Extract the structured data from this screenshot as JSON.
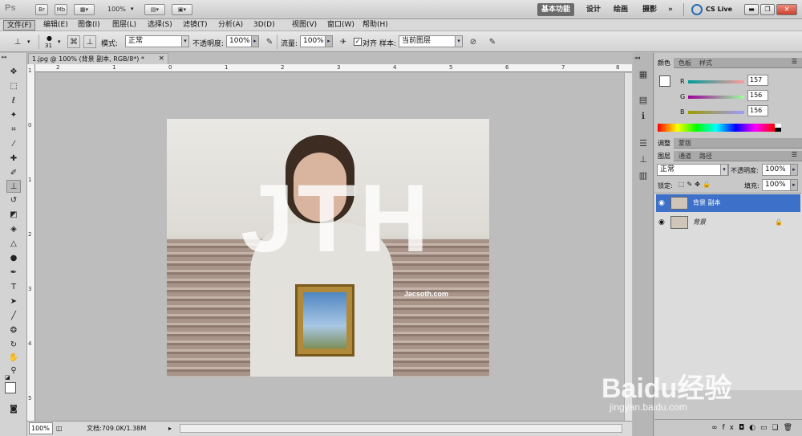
{
  "appbar": {
    "logo": "Ps",
    "br": "Br",
    "mb": "Mb",
    "zoom": "100%",
    "workspaces": [
      "基本功能",
      "设计",
      "绘画",
      "摄影"
    ],
    "more": "»",
    "cslive": "CS Live"
  },
  "menu": [
    "文件(F)",
    "编辑(E)",
    "图像(I)",
    "图层(L)",
    "选择(S)",
    "滤镜(T)",
    "分析(A)",
    "3D(D)",
    "视图(V)",
    "窗口(W)",
    "帮助(H)"
  ],
  "options": {
    "brush_size": "31",
    "mode_label": "模式:",
    "mode_value": "正常",
    "opacity_label": "不透明度:",
    "opacity_value": "100%",
    "flow_label": "流量:",
    "flow_value": "100%",
    "aligned_label": "对齐",
    "sample_label": "样本:",
    "sample_value": "当前图层"
  },
  "document": {
    "tab_title": "1.jpg @ 100% (背景 副本, RGB/8*) *",
    "close": "×"
  },
  "ruler": {
    "top": [
      "2",
      "1",
      "0",
      "1",
      "2",
      "3",
      "4",
      "5",
      "6",
      "7",
      "8"
    ],
    "left": [
      "1",
      "0",
      "1",
      "2",
      "3",
      "4",
      "5"
    ]
  },
  "image_text": {
    "big_letters": "JTH",
    "url": "Jacsoth.com"
  },
  "status": {
    "zoom": "100%",
    "doc_info": "文档:709.0K/1.38M"
  },
  "color_panel": {
    "tabs": [
      "颜色",
      "色板",
      "样式"
    ],
    "r_label": "R",
    "g_label": "G",
    "b_label": "B",
    "r_value": "157",
    "g_value": "156",
    "b_value": "156"
  },
  "adjust_panel": {
    "tabs": [
      "调整",
      "蒙版"
    ]
  },
  "layers_panel": {
    "tabs": [
      "图层",
      "通道",
      "路径"
    ],
    "blend_mode": "正常",
    "opacity_label": "不透明度:",
    "opacity_value": "100%",
    "lock_label": "锁定:",
    "fill_label": "填充:",
    "fill_value": "100%",
    "layers": [
      {
        "name": "背景 副本"
      },
      {
        "name": "背景"
      }
    ]
  },
  "watermark": {
    "brand": "Baidu经验",
    "url": "jingyan.baidu.com"
  }
}
